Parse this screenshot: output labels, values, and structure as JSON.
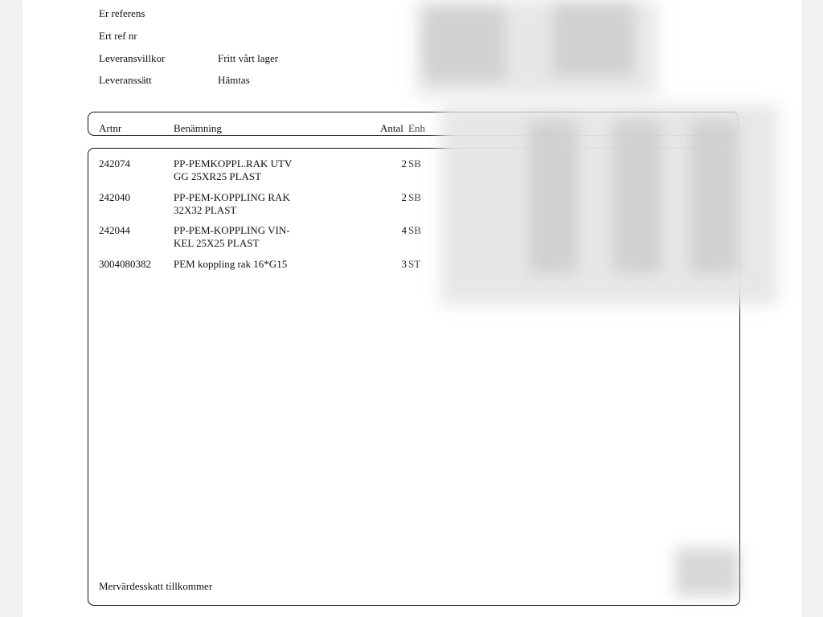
{
  "meta": {
    "labels": {
      "er_referens": "Er referens",
      "ert_ref_nr": "Ert ref nr",
      "leveransvillkor": "Leveransvillkor",
      "leveranssatt": "Leveranssätt"
    },
    "values": {
      "leveransvillkor": "Fritt vårt lager",
      "leveranssatt": "Hämtas"
    }
  },
  "table": {
    "headers": {
      "artnr": "Artnr",
      "benamning": "Benämning",
      "antal": "Antal",
      "enh": "Enh"
    },
    "rows": [
      {
        "artnr": "242074",
        "name_line1": "PP-PEMKOPPL.RAK UTV",
        "name_line2": "GG 25XR25 PLAST",
        "qty": "2",
        "unit": "SB"
      },
      {
        "artnr": "242040",
        "name_line1": "PP-PEM-KOPPLING RAK",
        "name_line2": "32X32 PLAST",
        "qty": "2",
        "unit": "SB"
      },
      {
        "artnr": "242044",
        "name_line1": "PP-PEM-KOPPLING VIN-",
        "name_line2": "KEL 25X25 PLAST",
        "qty": "4",
        "unit": "SB"
      },
      {
        "artnr": "3004080382",
        "name_line1": "PEM koppling rak 16*G15",
        "name_line2": "",
        "qty": "3",
        "unit": "ST"
      }
    ]
  },
  "footer": {
    "vat_note": "Mervärdesskatt tillkommer"
  }
}
